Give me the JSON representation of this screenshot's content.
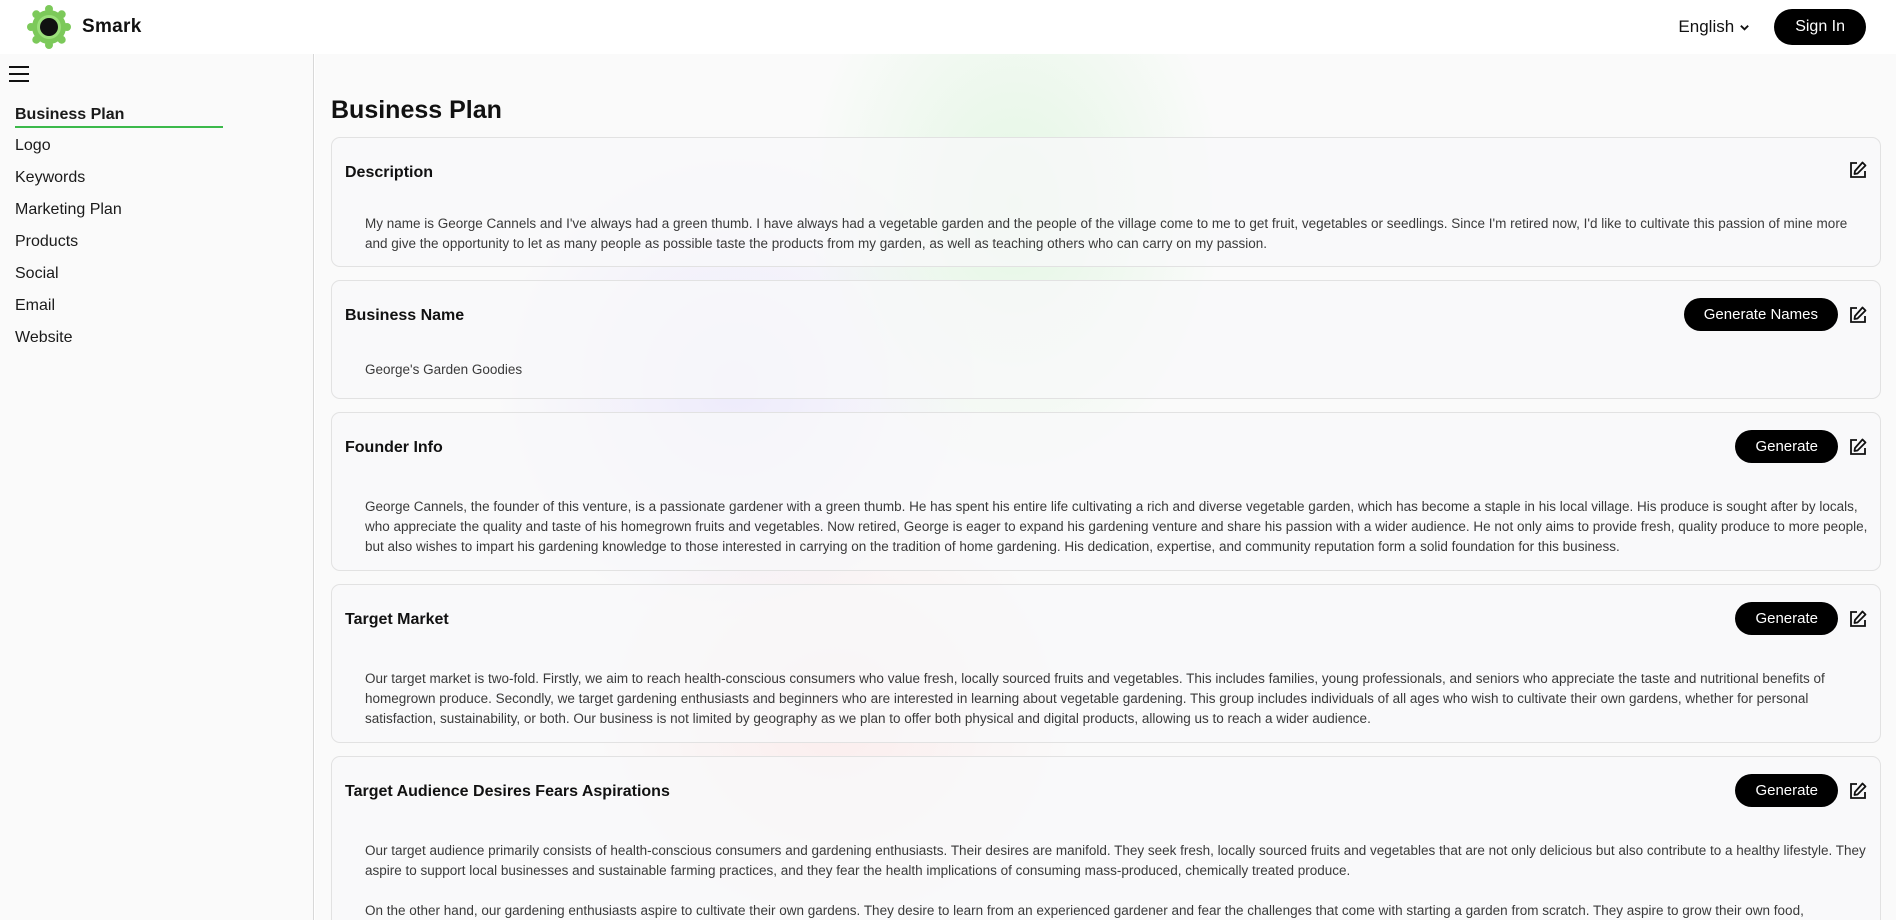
{
  "header": {
    "brand": "Smark",
    "language": "English",
    "signin_label": "Sign In"
  },
  "sidebar": {
    "items": [
      {
        "label": "Business Plan",
        "active": true
      },
      {
        "label": "Logo"
      },
      {
        "label": "Keywords"
      },
      {
        "label": "Marketing Plan"
      },
      {
        "label": "Products"
      },
      {
        "label": "Social"
      },
      {
        "label": "Email"
      },
      {
        "label": "Website"
      }
    ]
  },
  "main": {
    "title": "Business Plan",
    "sections": [
      {
        "heading": "Description",
        "button": "",
        "paragraphs": [
          "My name is George Cannels and I've always had a green thumb. I have always had a vegetable garden and the people of the village come to me to get fruit, vegetables or seedlings. Since I'm retired now, I'd like to cultivate this passion of mine more and give the opportunity to let as many people as possible taste the products from my garden, as well as teaching others who can carry on my passion."
        ]
      },
      {
        "heading": "Business Name",
        "button": "Generate Names",
        "paragraphs": [
          "George's Garden Goodies"
        ]
      },
      {
        "heading": "Founder Info",
        "button": "Generate",
        "paragraphs": [
          "George Cannels, the founder of this venture, is a passionate gardener with a green thumb. He has spent his entire life cultivating a rich and diverse vegetable garden, which has become a staple in his local village. His produce is sought after by locals, who appreciate the quality and taste of his homegrown fruits and vegetables. Now retired, George is eager to expand his gardening venture and share his passion with a wider audience. He not only aims to provide fresh, quality produce to more people, but also wishes to impart his gardening knowledge to those interested in carrying on the tradition of home gardening. His dedication, expertise, and community reputation form a solid foundation for this business."
        ]
      },
      {
        "heading": "Target Market",
        "button": "Generate",
        "paragraphs": [
          "Our target market is two-fold. Firstly, we aim to reach health-conscious consumers who value fresh, locally sourced fruits and vegetables. This includes families, young professionals, and seniors who appreciate the taste and nutritional benefits of homegrown produce. Secondly, we target gardening enthusiasts and beginners who are interested in learning about vegetable gardening. This group includes individuals of all ages who wish to cultivate their own gardens, whether for personal satisfaction, sustainability, or both. Our business is not limited by geography as we plan to offer both physical and digital products, allowing us to reach a wider audience."
        ]
      },
      {
        "heading": "Target Audience Desires Fears Aspirations",
        "button": "Generate",
        "paragraphs": [
          "Our target audience primarily consists of health-conscious consumers and gardening enthusiasts. Their desires are manifold. They seek fresh, locally sourced fruits and vegetables that are not only delicious but also contribute to a healthy lifestyle. They aspire to support local businesses and sustainable farming practices, and they fear the health implications of consuming mass-produced, chemically treated produce.",
          "On the other hand, our gardening enthusiasts aspire to cultivate their own gardens. They desire to learn from an experienced gardener and fear the challenges that come with starting a garden from scratch. They aspire to grow their own food,"
        ]
      }
    ]
  }
}
